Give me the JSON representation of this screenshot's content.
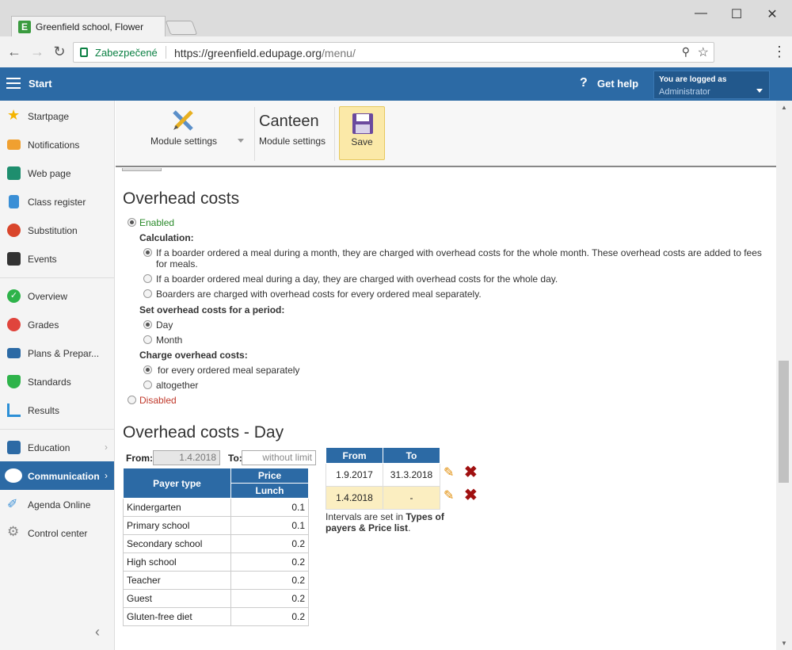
{
  "browser": {
    "tab_title": "Greenfield school, Flower",
    "favicon_letter": "E",
    "security_label": "Zabezpečené",
    "url_host": "https://greenfield.edupage.org",
    "url_path": "/menu/"
  },
  "header": {
    "start_label": "Start",
    "help_label": "Get help",
    "user": {
      "line1": "You are logged as",
      "line2": "Administrator"
    }
  },
  "sidebar": {
    "items": [
      {
        "label": "Startpage",
        "icon": "star-icon",
        "color": "#f4b400"
      },
      {
        "label": "Notifications",
        "icon": "envelope-icon",
        "color": "#f0a030"
      },
      {
        "label": "Web page",
        "icon": "house-icon",
        "color": "#1e8e6e"
      },
      {
        "label": "Class register",
        "icon": "book-icon",
        "color": "#3a8fd6"
      },
      {
        "label": "Substitution",
        "icon": "person-icon",
        "color": "#d9452b"
      },
      {
        "label": "Events",
        "icon": "calendar-icon",
        "color": "#333333"
      },
      {
        "label": "Overview",
        "icon": "check-icon",
        "color": "#2eb34a"
      },
      {
        "label": "Grades",
        "icon": "grades-icon",
        "color": "#e0443c"
      },
      {
        "label": "Plans & Prepar...",
        "icon": "briefcase-icon",
        "color": "#2c6aa5"
      },
      {
        "label": "Standards",
        "icon": "shield-icon",
        "color": "#2eb34a"
      },
      {
        "label": "Results",
        "icon": "bar-chart-icon",
        "color": "#2c8fd6"
      },
      {
        "label": "Education",
        "icon": "education-icon",
        "color": "#2c6aa5"
      },
      {
        "label": "Communication",
        "icon": "chat-icon",
        "color": "#ffffff"
      },
      {
        "label": "Agenda Online",
        "icon": "pen-icon",
        "color": "#3a8fd6"
      },
      {
        "label": "Control center",
        "icon": "gear-icon",
        "color": "#888888"
      }
    ]
  },
  "toolbar": {
    "module_settings_label": "Module settings",
    "title": "Canteen",
    "subtitle": "Module settings",
    "save_label": "Save"
  },
  "overhead": {
    "title": "Overhead costs",
    "enabled_label": "Enabled",
    "calculation_label": "Calculation:",
    "calc_options": [
      "If a boarder ordered a meal during a month, they are charged with overhead costs for the whole month. These overhead costs are added to fees",
      "for meals.",
      "If a boarder ordered meal during a day, they are charged with overhead costs for the whole day.",
      "Boarders are charged with overhead costs for every ordered meal separately."
    ],
    "period_label": "Set overhead costs for a period:",
    "period_options": [
      "Day",
      "Month"
    ],
    "charge_label": "Charge overhead costs:",
    "charge_options": [
      "for every ordered meal separately",
      "altogether"
    ],
    "disabled_label": "Disabled"
  },
  "day_section": {
    "title": "Overhead costs - Day",
    "from_label": "From:",
    "from_value": "1.4.2018",
    "to_label": "To:",
    "to_placeholder": "without limit",
    "table": {
      "payer_header": "Payer type",
      "price_header": "Price",
      "lunch_header": "Lunch",
      "rows": [
        {
          "name": "Kindergarten",
          "value": "0.1"
        },
        {
          "name": "Primary school",
          "value": "0.1"
        },
        {
          "name": "Secondary school",
          "value": "0.2"
        },
        {
          "name": "High school",
          "value": "0.2"
        },
        {
          "name": "Teacher",
          "value": "0.2"
        },
        {
          "name": "Guest",
          "value": "0.2"
        },
        {
          "name": "Gluten-free diet",
          "value": "0.2"
        }
      ]
    },
    "intervals": {
      "from_header": "From",
      "to_header": "To",
      "rows": [
        {
          "from": "1.9.2017",
          "to": "31.3.2018"
        },
        {
          "from": "1.4.2018",
          "to": "-"
        }
      ],
      "note_prefix": "Intervals are set in ",
      "note_link": "Types of payers & Price list",
      "note_suffix": "."
    }
  }
}
